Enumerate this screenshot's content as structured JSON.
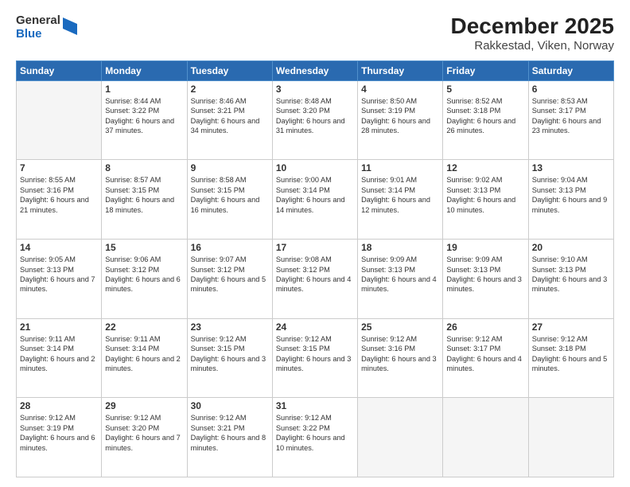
{
  "header": {
    "logo_general": "General",
    "logo_blue": "Blue",
    "title": "December 2025",
    "subtitle": "Rakkestad, Viken, Norway"
  },
  "days_of_week": [
    "Sunday",
    "Monday",
    "Tuesday",
    "Wednesday",
    "Thursday",
    "Friday",
    "Saturday"
  ],
  "weeks": [
    [
      {
        "day": "",
        "sunrise": "",
        "sunset": "",
        "daylight": ""
      },
      {
        "day": "1",
        "sunrise": "8:44 AM",
        "sunset": "3:22 PM",
        "daylight": "6 hours and 37 minutes."
      },
      {
        "day": "2",
        "sunrise": "8:46 AM",
        "sunset": "3:21 PM",
        "daylight": "6 hours and 34 minutes."
      },
      {
        "day": "3",
        "sunrise": "8:48 AM",
        "sunset": "3:20 PM",
        "daylight": "6 hours and 31 minutes."
      },
      {
        "day": "4",
        "sunrise": "8:50 AM",
        "sunset": "3:19 PM",
        "daylight": "6 hours and 28 minutes."
      },
      {
        "day": "5",
        "sunrise": "8:52 AM",
        "sunset": "3:18 PM",
        "daylight": "6 hours and 26 minutes."
      },
      {
        "day": "6",
        "sunrise": "8:53 AM",
        "sunset": "3:17 PM",
        "daylight": "6 hours and 23 minutes."
      }
    ],
    [
      {
        "day": "7",
        "sunrise": "8:55 AM",
        "sunset": "3:16 PM",
        "daylight": "6 hours and 21 minutes."
      },
      {
        "day": "8",
        "sunrise": "8:57 AM",
        "sunset": "3:15 PM",
        "daylight": "6 hours and 18 minutes."
      },
      {
        "day": "9",
        "sunrise": "8:58 AM",
        "sunset": "3:15 PM",
        "daylight": "6 hours and 16 minutes."
      },
      {
        "day": "10",
        "sunrise": "9:00 AM",
        "sunset": "3:14 PM",
        "daylight": "6 hours and 14 minutes."
      },
      {
        "day": "11",
        "sunrise": "9:01 AM",
        "sunset": "3:14 PM",
        "daylight": "6 hours and 12 minutes."
      },
      {
        "day": "12",
        "sunrise": "9:02 AM",
        "sunset": "3:13 PM",
        "daylight": "6 hours and 10 minutes."
      },
      {
        "day": "13",
        "sunrise": "9:04 AM",
        "sunset": "3:13 PM",
        "daylight": "6 hours and 9 minutes."
      }
    ],
    [
      {
        "day": "14",
        "sunrise": "9:05 AM",
        "sunset": "3:13 PM",
        "daylight": "6 hours and 7 minutes."
      },
      {
        "day": "15",
        "sunrise": "9:06 AM",
        "sunset": "3:12 PM",
        "daylight": "6 hours and 6 minutes."
      },
      {
        "day": "16",
        "sunrise": "9:07 AM",
        "sunset": "3:12 PM",
        "daylight": "6 hours and 5 minutes."
      },
      {
        "day": "17",
        "sunrise": "9:08 AM",
        "sunset": "3:12 PM",
        "daylight": "6 hours and 4 minutes."
      },
      {
        "day": "18",
        "sunrise": "9:09 AM",
        "sunset": "3:13 PM",
        "daylight": "6 hours and 4 minutes."
      },
      {
        "day": "19",
        "sunrise": "9:09 AM",
        "sunset": "3:13 PM",
        "daylight": "6 hours and 3 minutes."
      },
      {
        "day": "20",
        "sunrise": "9:10 AM",
        "sunset": "3:13 PM",
        "daylight": "6 hours and 3 minutes."
      }
    ],
    [
      {
        "day": "21",
        "sunrise": "9:11 AM",
        "sunset": "3:14 PM",
        "daylight": "6 hours and 2 minutes."
      },
      {
        "day": "22",
        "sunrise": "9:11 AM",
        "sunset": "3:14 PM",
        "daylight": "6 hours and 2 minutes."
      },
      {
        "day": "23",
        "sunrise": "9:12 AM",
        "sunset": "3:15 PM",
        "daylight": "6 hours and 3 minutes."
      },
      {
        "day": "24",
        "sunrise": "9:12 AM",
        "sunset": "3:15 PM",
        "daylight": "6 hours and 3 minutes."
      },
      {
        "day": "25",
        "sunrise": "9:12 AM",
        "sunset": "3:16 PM",
        "daylight": "6 hours and 3 minutes."
      },
      {
        "day": "26",
        "sunrise": "9:12 AM",
        "sunset": "3:17 PM",
        "daylight": "6 hours and 4 minutes."
      },
      {
        "day": "27",
        "sunrise": "9:12 AM",
        "sunset": "3:18 PM",
        "daylight": "6 hours and 5 minutes."
      }
    ],
    [
      {
        "day": "28",
        "sunrise": "9:12 AM",
        "sunset": "3:19 PM",
        "daylight": "6 hours and 6 minutes."
      },
      {
        "day": "29",
        "sunrise": "9:12 AM",
        "sunset": "3:20 PM",
        "daylight": "6 hours and 7 minutes."
      },
      {
        "day": "30",
        "sunrise": "9:12 AM",
        "sunset": "3:21 PM",
        "daylight": "6 hours and 8 minutes."
      },
      {
        "day": "31",
        "sunrise": "9:12 AM",
        "sunset": "3:22 PM",
        "daylight": "6 hours and 10 minutes."
      },
      {
        "day": "",
        "sunrise": "",
        "sunset": "",
        "daylight": ""
      },
      {
        "day": "",
        "sunrise": "",
        "sunset": "",
        "daylight": ""
      },
      {
        "day": "",
        "sunrise": "",
        "sunset": "",
        "daylight": ""
      }
    ]
  ]
}
